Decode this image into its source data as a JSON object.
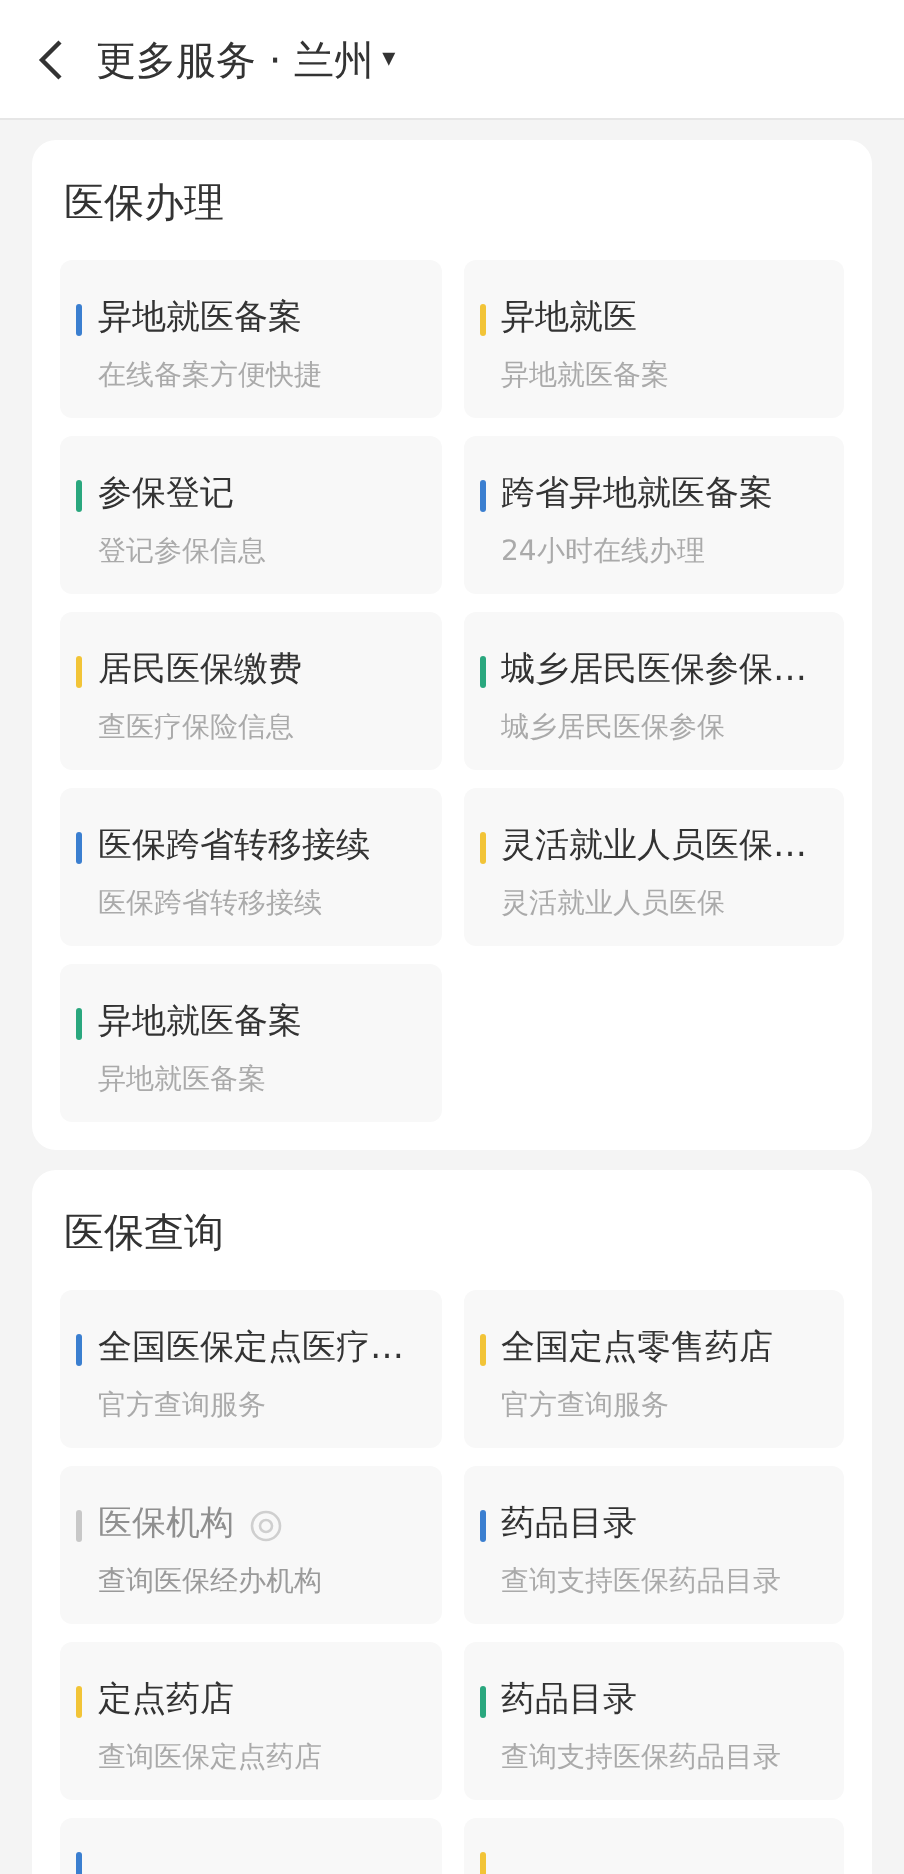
{
  "header": {
    "title": "更多服务 · 兰州",
    "caret": "▾"
  },
  "sections": [
    {
      "title": "医保办理",
      "items": [
        {
          "title": "异地就医备案",
          "subtitle": "在线备案方便快捷",
          "color": "#3b7fd0",
          "disabled": false
        },
        {
          "title": "异地就医",
          "subtitle": "异地就医备案",
          "color": "#f2c437",
          "disabled": false
        },
        {
          "title": "参保登记",
          "subtitle": "登记参保信息",
          "color": "#2aa77e",
          "disabled": false
        },
        {
          "title": "跨省异地就医备案",
          "subtitle": "24小时在线办理",
          "color": "#3b7fd0",
          "disabled": false
        },
        {
          "title": "居民医保缴费",
          "subtitle": "查医疗保险信息",
          "color": "#f2c437",
          "disabled": false
        },
        {
          "title": "城乡居民医保参保…",
          "subtitle": "城乡居民医保参保",
          "color": "#2aa77e",
          "disabled": false
        },
        {
          "title": "医保跨省转移接续",
          "subtitle": "医保跨省转移接续",
          "color": "#3b7fd0",
          "disabled": false
        },
        {
          "title": "灵活就业人员医保…",
          "subtitle": "灵活就业人员医保",
          "color": "#f2c437",
          "disabled": false
        },
        {
          "title": "异地就医备案",
          "subtitle": "异地就医备案",
          "color": "#2aa77e",
          "disabled": false
        }
      ]
    },
    {
      "title": "医保查询",
      "items": [
        {
          "title": "全国医保定点医疗…",
          "subtitle": "官方查询服务",
          "color": "#3b7fd0",
          "disabled": false
        },
        {
          "title": "全国定点零售药店",
          "subtitle": "官方查询服务",
          "color": "#f2c437",
          "disabled": false
        },
        {
          "title": "医保机构",
          "subtitle": "查询医保经办机构",
          "color": "#c8c8c8",
          "disabled": true,
          "has_icon": true
        },
        {
          "title": "药品目录",
          "subtitle": "查询支持医保药品目录",
          "color": "#3b7fd0",
          "disabled": false
        },
        {
          "title": "定点药店",
          "subtitle": "查询医保定点药店",
          "color": "#f2c437",
          "disabled": false
        },
        {
          "title": "药品目录",
          "subtitle": "查询支持医保药品目录",
          "color": "#2aa77e",
          "disabled": false
        },
        {
          "color": "#3b7fd0"
        },
        {
          "color": "#f2c437"
        }
      ]
    }
  ]
}
